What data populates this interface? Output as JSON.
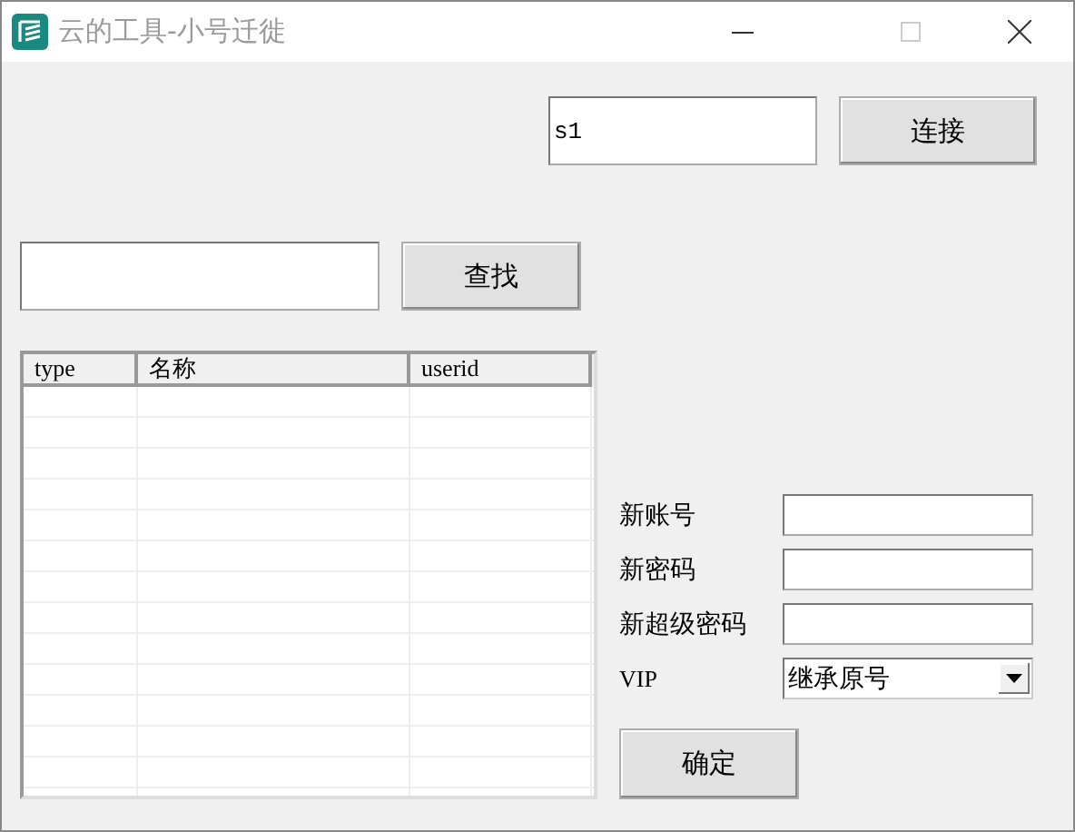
{
  "window": {
    "title": "云的工具-小号迁徙"
  },
  "connect": {
    "value": "s1",
    "button": "连接"
  },
  "search": {
    "button": "查找"
  },
  "table": {
    "columns": [
      "type",
      "名称",
      "userid"
    ]
  },
  "form": {
    "fields": [
      {
        "label": "新账号",
        "kind": "text"
      },
      {
        "label": "新密码",
        "kind": "text"
      },
      {
        "label": "新超级密码",
        "kind": "text"
      },
      {
        "label": "VIP",
        "kind": "select",
        "value": "继承原号"
      }
    ],
    "button": "确定"
  }
}
